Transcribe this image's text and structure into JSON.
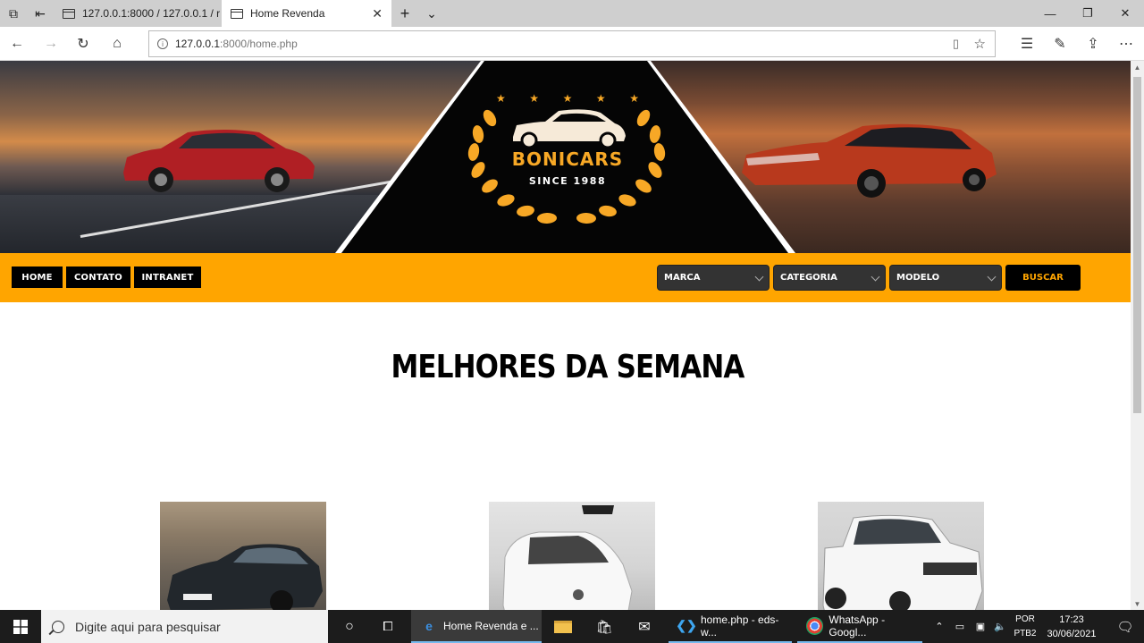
{
  "browser": {
    "tabs": [
      {
        "label": "127.0.0.1:8000 / 127.0.0.1 / r"
      },
      {
        "label": "Home Revenda"
      }
    ],
    "url_host": "127.0.0.1",
    "url_path": ":8000/home.php"
  },
  "site": {
    "brand": "BONICARS",
    "since": "SINCE 1988",
    "menu": [
      "HOME",
      "CONTATO",
      "INTRANET"
    ],
    "filters": [
      "MARCA",
      "CATEGORIA",
      "MODELO"
    ],
    "search_button": "BUSCAR",
    "section_title": "MELHORES DA SEMANA"
  },
  "taskbar": {
    "search_placeholder": "Digite aqui para pesquisar",
    "apps": [
      {
        "label": "Home Revenda e ..."
      },
      {
        "label": "home.php - eds-w..."
      },
      {
        "label": "WhatsApp - Googl..."
      }
    ],
    "language": [
      "POR",
      "PTB2"
    ],
    "time": "17:23",
    "date": "30/06/2021"
  },
  "colors": {
    "accent": "#ffa500",
    "menu_button": "#000000",
    "select_bg": "#333333"
  }
}
